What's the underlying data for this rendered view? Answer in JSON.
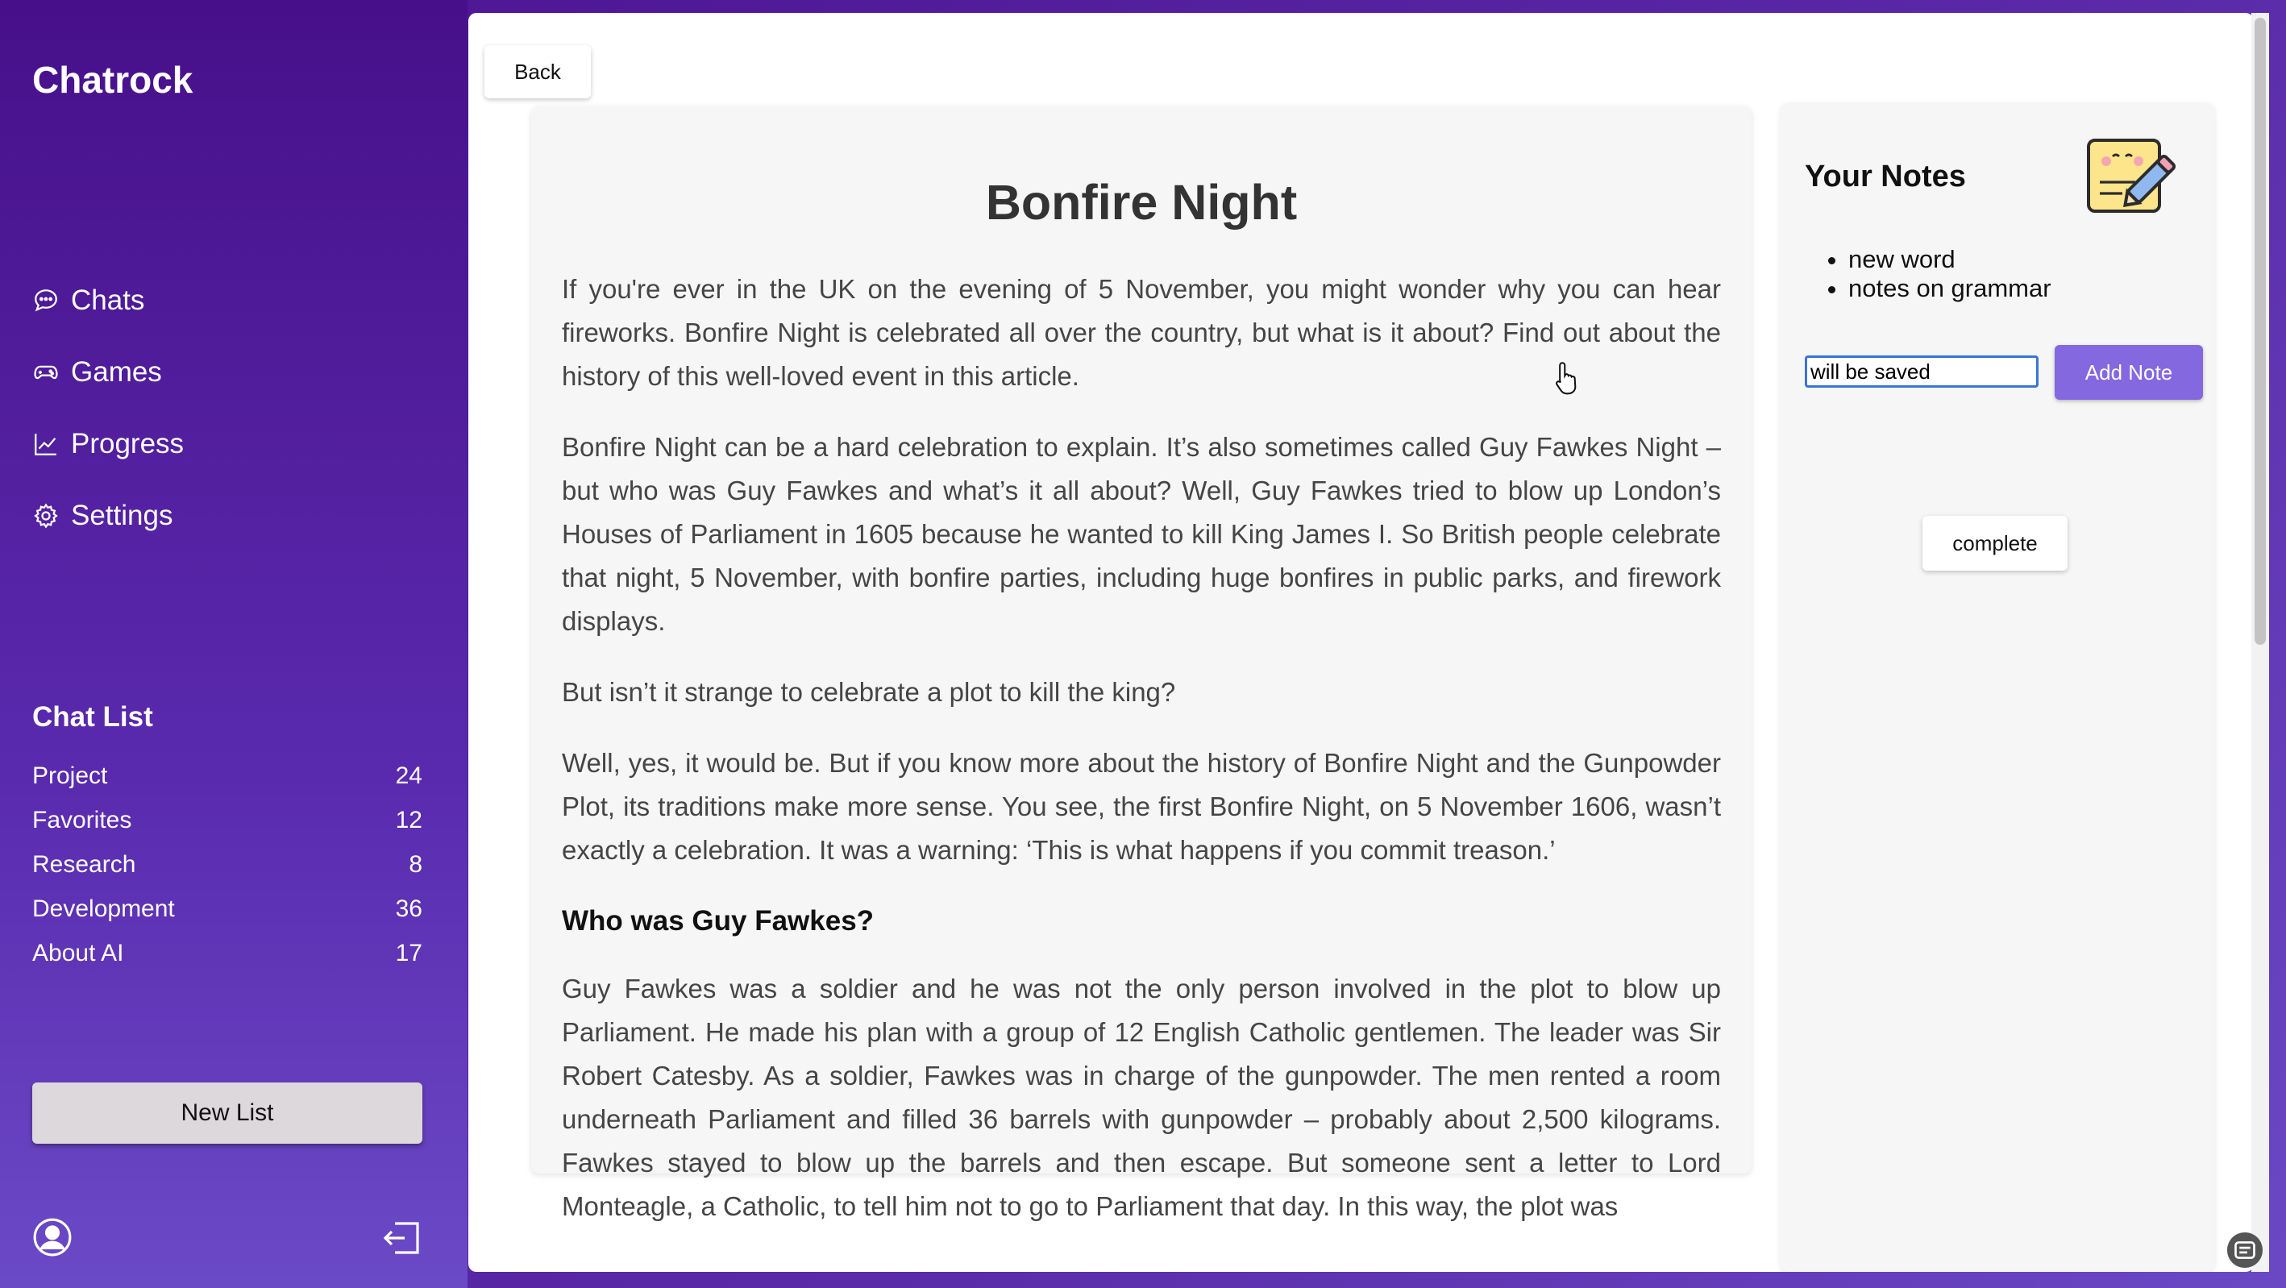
{
  "sidebar": {
    "brand": "Chatrock",
    "nav": [
      {
        "label": "Chats",
        "icon": "chat-bubble-icon"
      },
      {
        "label": "Games",
        "icon": "gamepad-icon"
      },
      {
        "label": "Progress",
        "icon": "line-chart-icon"
      },
      {
        "label": "Settings",
        "icon": "gear-icon"
      }
    ],
    "chat_list_title": "Chat List",
    "chat_list": [
      {
        "name": "Project",
        "count": "24"
      },
      {
        "name": "Favorites",
        "count": "12"
      },
      {
        "name": "Research",
        "count": "8"
      },
      {
        "name": "Development",
        "count": "36"
      },
      {
        "name": "About AI",
        "count": "17"
      }
    ],
    "new_list_label": "New List",
    "footer_icons": [
      "user-avatar-icon",
      "logout-icon"
    ]
  },
  "main": {
    "back_label": "Back",
    "article": {
      "title": "Bonfire Night",
      "paragraphs": [
        "If you're ever in the UK on the evening of 5 November, you might wonder why you can hear fireworks. Bonfire Night is celebrated all over the country, but what is it about? Find out about the history of this well-loved event in this article.",
        "Bonfire Night can be a hard celebration to explain. It’s also sometimes called Guy Fawkes Night – but who was Guy Fawkes and what’s it all about? Well, Guy Fawkes tried to blow up London’s Houses of Parliament in 1605 because he wanted to kill King James I. So British people celebrate that night, 5 November, with bonfire parties, including huge bonfires in public parks, and firework displays.",
        "But isn’t it strange to celebrate a plot to kill the king?",
        "Well, yes, it would be. But if you know more about the history of Bonfire Night and the Gunpowder Plot, its traditions make more sense. You see, the first Bonfire Night, on 5 November 1606, wasn’t exactly a celebration. It was a warning: ‘This is what happens if you commit treason.’"
      ],
      "subheading": "Who was Guy Fawkes?",
      "paragraph_after": "Guy Fawkes was a soldier and he was not the only person involved in the plot to blow up Parliament. He made his plan with a group of 12 English Catholic gentlemen. The leader was Sir Robert Catesby. As a soldier, Fawkes was in charge of the gunpowder. The men rented a room underneath Parliament and filled 36 barrels with gunpowder – probably about 2,500 kilograms. Fawkes stayed to blow up the barrels and then escape. But someone sent a letter to Lord Monteagle, a Catholic, to tell him not to go to Parliament that day. In this way, the plot was"
    },
    "notes": {
      "title": "Your Notes",
      "icon": "sticky-note-pencil-icon",
      "items": [
        "new word",
        "notes on grammar"
      ],
      "input_value": "will be saved",
      "add_label": "Add Note",
      "complete_label": "complete"
    }
  },
  "colors": {
    "sidebar_gradient_top": "#47108a",
    "sidebar_gradient_bottom": "#6b4ac6",
    "accent_button": "#8468e0",
    "input_focus": "#3a74d8"
  }
}
